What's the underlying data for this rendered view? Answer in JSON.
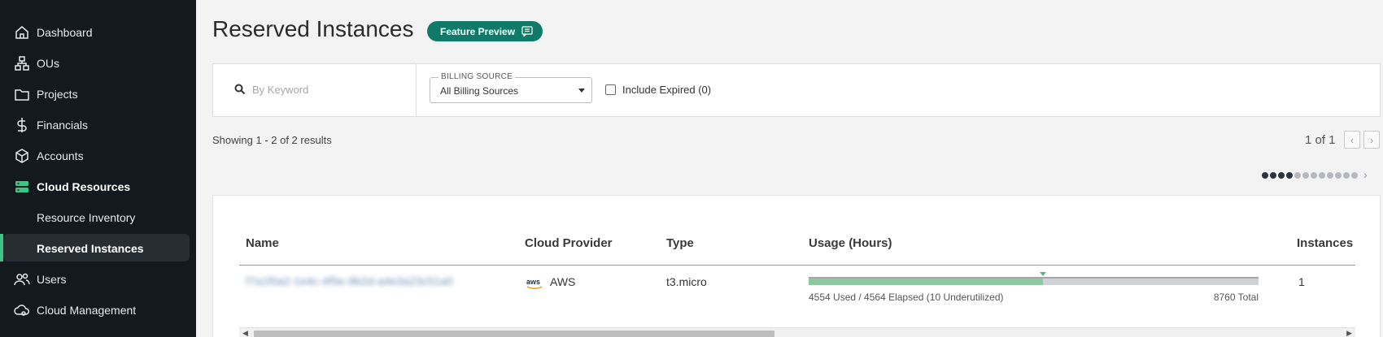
{
  "sidebar": {
    "items": [
      {
        "label": "Dashboard",
        "icon": "home-icon"
      },
      {
        "label": "OUs",
        "icon": "org-tree-icon"
      },
      {
        "label": "Projects",
        "icon": "folder-icon"
      },
      {
        "label": "Financials",
        "icon": "dollar-icon"
      },
      {
        "label": "Accounts",
        "icon": "cube-icon"
      },
      {
        "label": "Cloud Resources",
        "icon": "server-icon",
        "active": true
      },
      {
        "label": "Users",
        "icon": "users-icon"
      },
      {
        "label": "Cloud Management",
        "icon": "cloud-gear-icon"
      }
    ],
    "subitems": [
      {
        "label": "Resource Inventory"
      },
      {
        "label": "Reserved Instances",
        "selected": true
      }
    ]
  },
  "header": {
    "title": "Reserved Instances",
    "badge": "Feature Preview"
  },
  "filters": {
    "search_placeholder": "By Keyword",
    "billing_label": "BILLING SOURCE",
    "billing_value": "All Billing Sources",
    "include_expired": "Include Expired (0)"
  },
  "results": {
    "showing": "Showing 1 - 2 of 2 results",
    "page": "1 of 1",
    "prev": "‹",
    "next": "›"
  },
  "table": {
    "columns": [
      "Name",
      "Cloud Provider",
      "Type",
      "Usage (Hours)",
      "Instances"
    ],
    "rows": [
      {
        "name": "f7a1f0a2-1e4c-4f5e-9b2d-a4e3a23c51a0",
        "provider": "AWS",
        "provider_logo": "aws",
        "type": "t3.micro",
        "usage_used_fraction": 0.52,
        "usage_caption": "4554 Used / 4564 Elapsed (10 Underutilized)",
        "usage_total": "8760 Total",
        "instances": "1"
      }
    ]
  },
  "colors": {
    "sidebar_bg": "#13191d",
    "accent": "#3ec486",
    "badge_bg": "#0f7a68",
    "usage_fill": "#8cc8a0"
  }
}
